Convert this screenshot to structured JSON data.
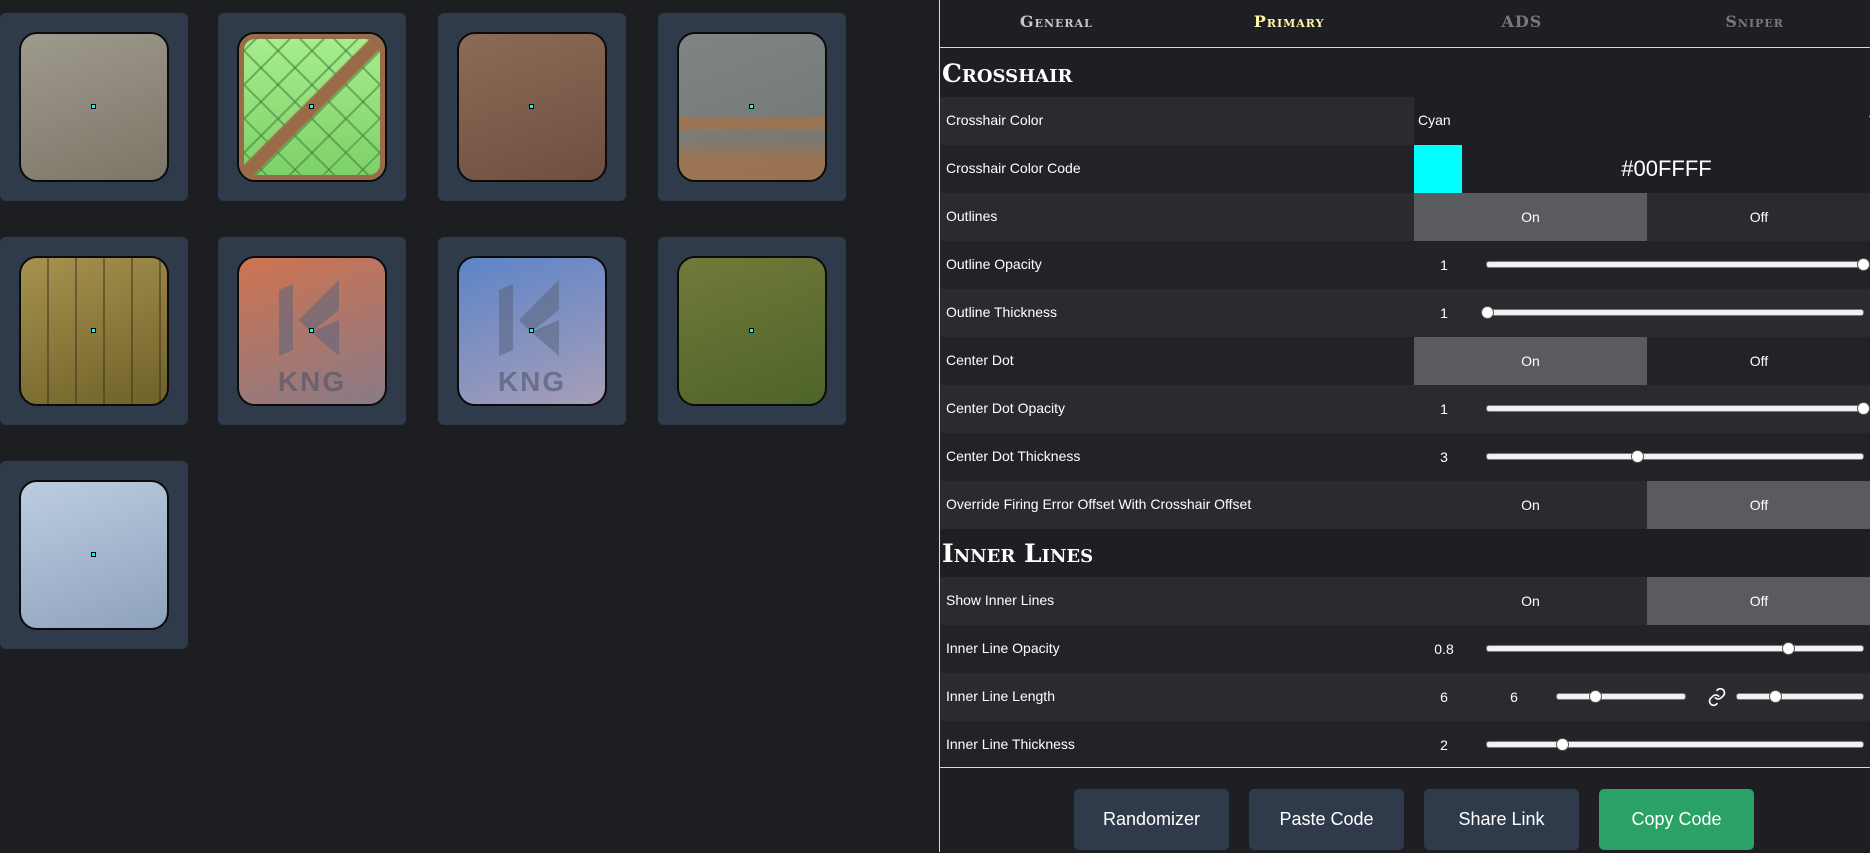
{
  "tabs": [
    {
      "label": "General"
    },
    {
      "label": "Primary"
    },
    {
      "label": "ADS"
    },
    {
      "label": "Sniper"
    }
  ],
  "preview": {
    "backgrounds": [
      {
        "name": "concrete",
        "colors": [
          "#9e9a8d",
          "#7c7668"
        ]
      },
      {
        "name": "green-tiles",
        "colors": [
          "#a8ef8e",
          "#7ccf67"
        ]
      },
      {
        "name": "rusty-brown",
        "colors": [
          "#8d6a56",
          "#6e4f40"
        ]
      },
      {
        "name": "grey-rust",
        "colors": [
          "#7e8584",
          "#b36f3a"
        ]
      },
      {
        "name": "wooden-planks",
        "colors": [
          "#a69250",
          "#6f6128"
        ]
      },
      {
        "name": "orange-wall-logo",
        "colors": [
          "#cf7350",
          "#8a7a86"
        ]
      },
      {
        "name": "blue-wall-logo",
        "colors": [
          "#5c84c8",
          "#a79eb8"
        ]
      },
      {
        "name": "grass",
        "colors": [
          "#717a3a",
          "#4e6428"
        ]
      },
      {
        "name": "sky",
        "colors": [
          "#bdcde0",
          "#8da2bd"
        ]
      }
    ],
    "logo_text": "KNG"
  },
  "crosshair": {
    "title": "Crosshair",
    "color_label": "Crosshair Color",
    "color_value": "Cyan",
    "color_code_label": "Crosshair Color Code",
    "color_code": "#00FFFF",
    "color_hex": "#00ffff",
    "outlines_label": "Outlines",
    "outlines": "On",
    "outline_opacity_label": "Outline Opacity",
    "outline_opacity": "1",
    "outline_opacity_fraction": 1.0,
    "outline_thickness_label": "Outline Thickness",
    "outline_thickness": "1",
    "outline_thickness_fraction": 0.0,
    "center_dot_label": "Center Dot",
    "center_dot": "On",
    "center_dot_opacity_label": "Center Dot Opacity",
    "center_dot_opacity": "1",
    "center_dot_opacity_fraction": 1.0,
    "center_dot_thickness_label": "Center Dot Thickness",
    "center_dot_thickness": "3",
    "center_dot_thickness_fraction": 0.4,
    "override_label": "Override Firing Error Offset With Crosshair Offset",
    "override": "Off"
  },
  "inner_lines": {
    "title": "Inner Lines",
    "show_label": "Show Inner Lines",
    "show": "Off",
    "opacity_label": "Inner Line Opacity",
    "opacity": "0.8",
    "opacity_fraction": 0.8,
    "length_label": "Inner Line Length",
    "length_a": "6",
    "length_b": "6",
    "length_fraction": 0.3,
    "thickness_label": "Inner Line Thickness",
    "thickness": "2",
    "thickness_fraction": 0.2
  },
  "toggle_labels": {
    "on": "On",
    "off": "Off"
  },
  "buttons": {
    "randomizer": "Randomizer",
    "paste_code": "Paste Code",
    "share_link": "Share Link",
    "copy_code": "Copy Code"
  }
}
